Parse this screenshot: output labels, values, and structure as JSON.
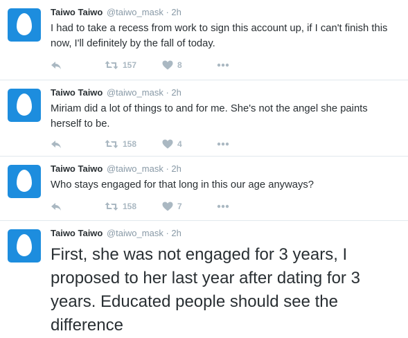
{
  "tweets": [
    {
      "name": "Taiwo Taiwo",
      "handle": "@taiwo_mask",
      "separator": "·",
      "time": "2h",
      "text": "I had to take a recess from work to sign this account up, if I can't finish this now, I'll definitely by the fall of today.",
      "retweets": "157",
      "likes": "8"
    },
    {
      "name": "Taiwo Taiwo",
      "handle": "@taiwo_mask",
      "separator": "·",
      "time": "2h",
      "text": "Miriam did a lot of things to and for me. She's not the angel she paints herself to be.",
      "retweets": "158",
      "likes": "4"
    },
    {
      "name": "Taiwo Taiwo",
      "handle": "@taiwo_mask",
      "separator": "·",
      "time": "2h",
      "text": "Who stays engaged for that long in this our age anyways?",
      "retweets": "158",
      "likes": "7"
    },
    {
      "name": "Taiwo Taiwo",
      "handle": "@taiwo_mask",
      "separator": "·",
      "time": "2h",
      "text": "First, she was not engaged for 3 years, I proposed to her last year after dating for 3 years. Educated people should see the difference"
    }
  ],
  "icons": {
    "avatar": "default-egg-avatar",
    "reply": "reply-icon",
    "retweet": "retweet-icon",
    "like": "heart-icon",
    "more": "more-dots-icon"
  },
  "colors": {
    "avatar_bg": "#1d8dde",
    "action_gray": "#aab8c2",
    "meta_gray": "#8899a6",
    "text": "#292f33",
    "divider": "#e1e8ed"
  }
}
